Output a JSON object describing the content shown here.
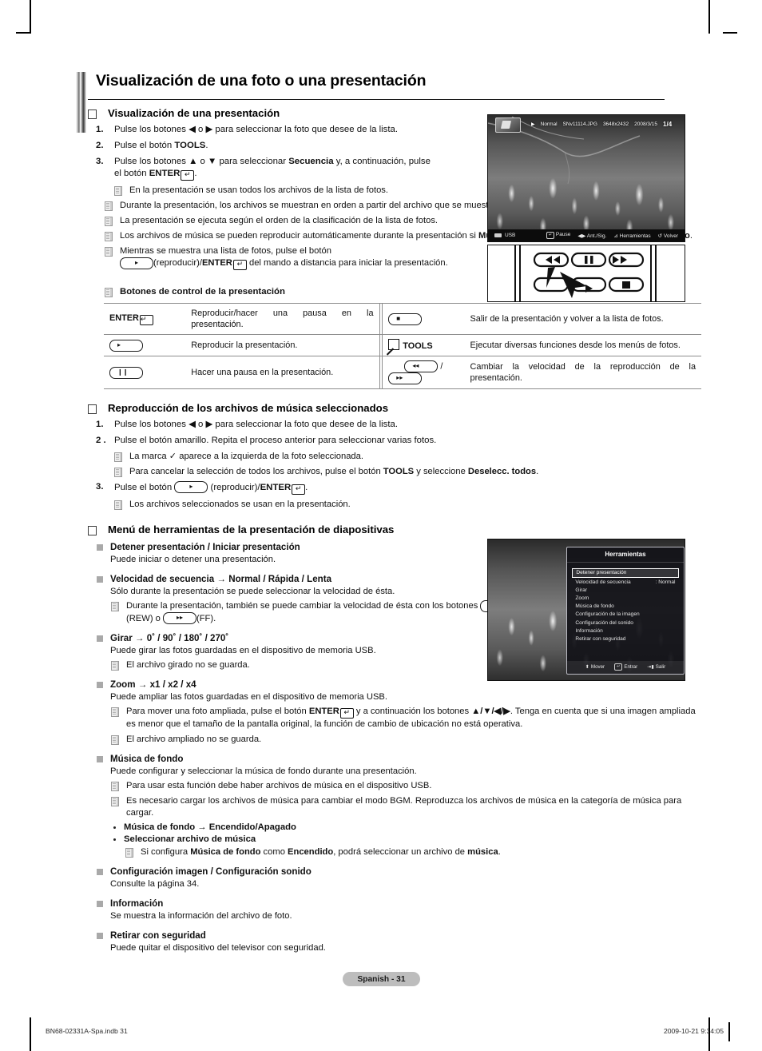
{
  "document": {
    "title": "Visualización de una foto o una presentación",
    "folio": "Spanish - 31",
    "footer_left": "BN68-02331A-Spa.indb   31",
    "footer_right": "2009-10-21   9:34:05"
  },
  "section_slideshow": {
    "heading": "Visualización de una presentación",
    "steps": [
      {
        "n": "1.",
        "text": "Pulse los botones ◀ o ▶ para seleccionar la foto que desee de la lista."
      },
      {
        "n": "2.",
        "text": "Pulse el botón TOOLS."
      },
      {
        "n": "3.",
        "text": "Pulse los botones ▲ o ▼ para seleccionar Secuencia y, a continuación, pulse el botón ENTER."
      }
    ],
    "step3_note": "En la presentación se usan todos los archivos de la lista de fotos.",
    "notes": [
      "Durante la presentación, los archivos se muestran en orden a partir del archivo que se muestra en este momento.",
      "La presentación se ejecuta según el orden de la clasificación de la lista de fotos.",
      "Los archivos de música se pueden reproducir automáticamente durante la presentación si Música de fondo está configurado como Encendido.",
      "Mientras se muestra una lista de fotos, pulse el botón (reproducir)/ENTER del mando a distancia para iniciar la presentación."
    ]
  },
  "control_table": {
    "caption": "Botones de control de la presentación",
    "rows": [
      {
        "key_left": "ENTER",
        "desc_left": "Reproducir/hacer una pausa en la presentación.",
        "key_right": "stop-key",
        "desc_right": "Salir de la presentación y volver a la lista de fotos."
      },
      {
        "key_left": "play-key",
        "desc_left": "Reproducir la presentación.",
        "key_right": "TOOLS",
        "desc_right": "Ejecutar diversas funciones desde los menús de fotos."
      },
      {
        "key_left": "pause-key",
        "desc_left": "Hacer una pausa en la presentación.",
        "key_right": "rew-ff-keys",
        "desc_right": "Cambiar la velocidad de la reproducción de la presentación."
      }
    ]
  },
  "section_music": {
    "heading": "Reproducción de los archivos de música seleccionados",
    "steps": [
      {
        "n": "1.",
        "text": "Pulse los botones ◀ o ▶ para seleccionar la foto que desee de la lista."
      },
      {
        "n": "2 .",
        "text": "Pulse el botón amarillo. Repita el proceso anterior para seleccionar varias fotos."
      },
      {
        "n": "3.",
        "text": "Pulse el botón (reproducir)/ENTER."
      }
    ],
    "step2_notes": [
      "La marca ✓ aparece a la izquierda de la foto seleccionada.",
      "Para cancelar la selección de todos los archivos, pulse el botón TOOLS y seleccione Deselecc. todos."
    ],
    "step3_note": "Los archivos seleccionados se usan en la presentación."
  },
  "section_tools": {
    "heading": "Menú de herramientas de la presentación de diapositivas",
    "items": [
      {
        "title": "Detener presentación / Iniciar presentación",
        "body": "Puede iniciar o detener una presentación.",
        "notes": []
      },
      {
        "title": "Velocidad de secuencia → Normal / Rápida / Lenta",
        "body": "Sólo durante la presentación se puede seleccionar la velocidad de ésta.",
        "notes": [
          "Durante la presentación, también se puede cambiar la velocidad de ésta con los botones (REW) o (FF)."
        ]
      },
      {
        "title": "Girar → 0˚ / 90˚ / 180˚ / 270˚",
        "body": "Puede girar las fotos guardadas en el dispositivo de memoria USB.",
        "notes": [
          "El archivo girado no se guarda."
        ]
      },
      {
        "title": "Zoom → x1 / x2 / x4",
        "body": "Puede ampliar las fotos guardadas en el dispositivo de memoria USB.",
        "notes": [
          "Para mover una foto ampliada, pulse el botón ENTER y a continuación los botones ▲/▼/◀/▶. Tenga en cuenta que si una imagen ampliada es menor que el tamaño de la pantalla original, la función de cambio de ubicación no está operativa.",
          "El archivo ampliado no se guarda."
        ]
      },
      {
        "title": "Música de fondo",
        "body": "Puede configurar y seleccionar la música de fondo durante una presentación.",
        "notes": [
          "Para usar esta función debe haber archivos de música en el dispositivo USB.",
          "Es necesario cargar los archivos de música para cambiar el modo BGM. Reproduzca los archivos de música en la categoría de música para cargar."
        ],
        "subitems": [
          {
            "title": "Música de fondo → Encendido/Apagado"
          },
          {
            "title": "Seleccionar archivo de música",
            "note": "Si configura Música de fondo como Encendido, podrá seleccionar un archivo de música."
          }
        ]
      },
      {
        "title": "Configuración imagen / Configuración sonido",
        "body": "Consulte la página 34.",
        "notes": []
      },
      {
        "title": "Información",
        "body": "Se muestra la información del archivo de foto.",
        "notes": []
      },
      {
        "title": "Retirar con seguridad",
        "body": "Puede quitar el dispositivo del televisor con seguridad.",
        "notes": []
      }
    ]
  },
  "photo_screenshot": {
    "mode": "Normal",
    "filename": "SNv11114.JPG",
    "resolution": "3648x2432",
    "date": "2008/3/15",
    "counter": "1/4",
    "source": "USB",
    "hints": [
      {
        "key": "enter",
        "label": "Pause"
      },
      {
        "key": "leftright",
        "label": "Ant./Sig."
      },
      {
        "key": "tools",
        "label": "Herramientas"
      },
      {
        "key": "return",
        "label": "Volver"
      }
    ]
  },
  "tools_screenshot": {
    "title": "Herramientas",
    "rows": [
      {
        "label": "Detener presentación",
        "value": "",
        "selected": true
      },
      {
        "label": "Velocidad de secuencia",
        "value": ": Normal",
        "selected": false
      },
      {
        "label": "Girar",
        "value": "",
        "selected": false
      },
      {
        "label": "Zoom",
        "value": "",
        "selected": false
      },
      {
        "label": "Música de fondo",
        "value": "",
        "selected": false
      },
      {
        "label": "Configuración de la imagen",
        "value": "",
        "selected": false
      },
      {
        "label": "Configuración del sonido",
        "value": "",
        "selected": false
      },
      {
        "label": "Información",
        "value": "",
        "selected": false
      },
      {
        "label": "Retirar con seguridad",
        "value": "",
        "selected": false
      }
    ],
    "hints": [
      {
        "key": "updown",
        "label": "Mover"
      },
      {
        "key": "enter",
        "label": "Entrar"
      },
      {
        "key": "exit",
        "label": "Salir"
      }
    ]
  },
  "remote_diagram": {
    "buttons": [
      "rew",
      "pause",
      "ff",
      "left-arrow",
      "play",
      "stop"
    ]
  }
}
